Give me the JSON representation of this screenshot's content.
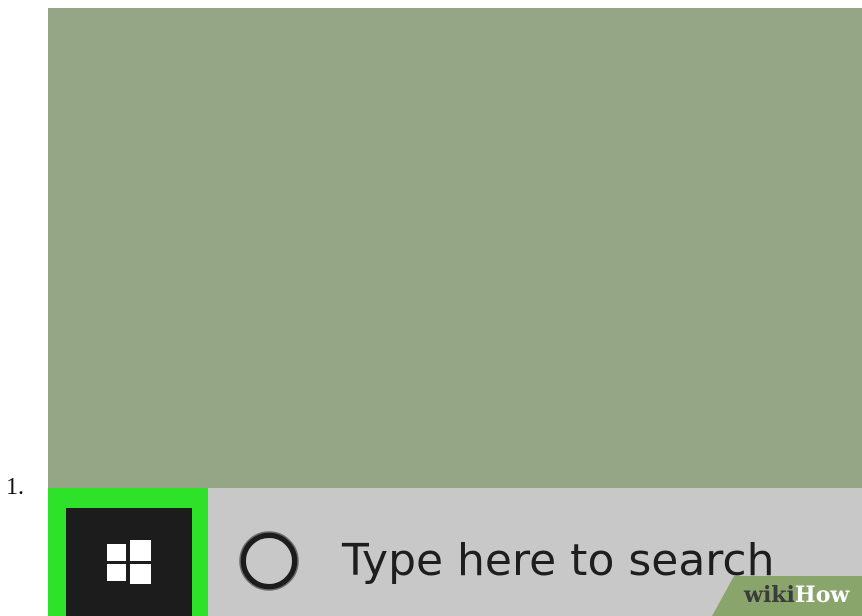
{
  "step": {
    "number_label": "1."
  },
  "desktop": {
    "background_color": "#94a686"
  },
  "taskbar": {
    "background_color": "#c8c8c8",
    "start_button": {
      "icon": "windows-logo-icon",
      "highlight_color": "#2ee22a",
      "background_color": "#1c1c1c"
    },
    "search": {
      "icon": "cortana-circle-icon",
      "placeholder": "Type here to search"
    }
  },
  "watermark": {
    "brand_part1": "wiki",
    "brand_part2": "How",
    "background_color": "#8aa56b"
  }
}
